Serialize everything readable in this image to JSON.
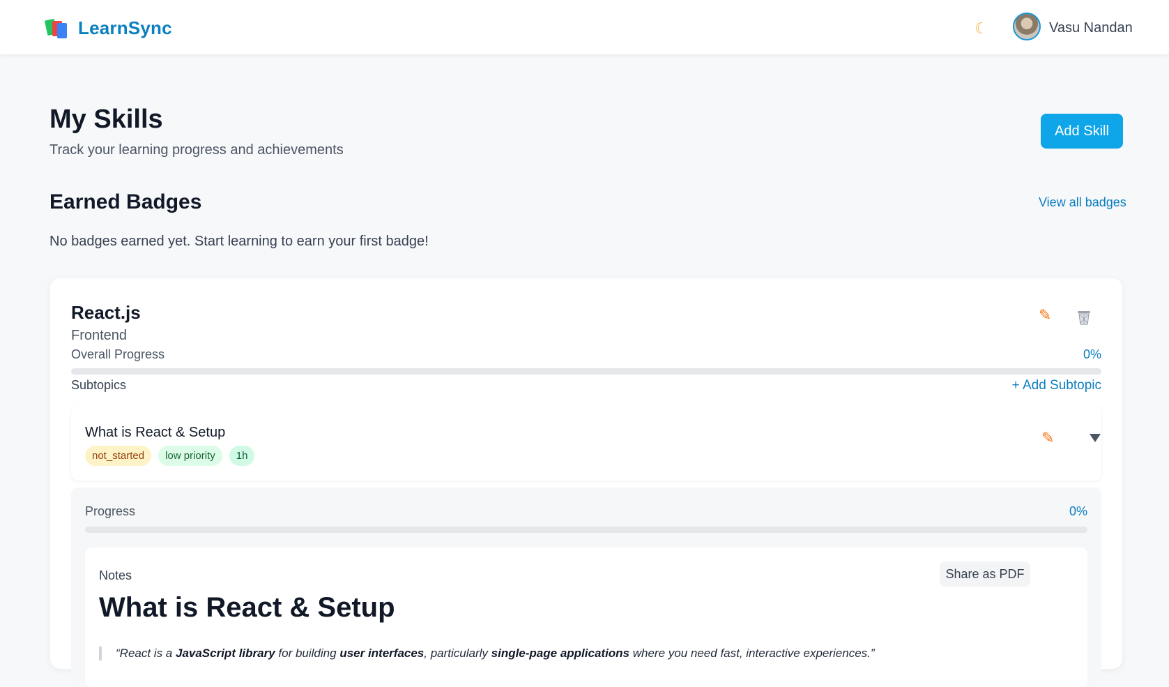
{
  "header": {
    "brand": "LearnSync",
    "user_name": "Vasu Nandan",
    "theme_icon": "moon-icon"
  },
  "page": {
    "title": "My Skills",
    "subtitle": "Track your learning progress and achievements",
    "add_skill_label": "Add Skill"
  },
  "badges": {
    "title": "Earned Badges",
    "view_all_label": "View all badges",
    "empty_text": "No badges earned yet. Start learning to earn your first badge!"
  },
  "skill": {
    "name": "React.js",
    "category": "Frontend",
    "overall_label": "Overall Progress",
    "overall_percent_text": "0%",
    "overall_progress": 0,
    "subtopics_label": "Subtopics",
    "add_subtopic_label": "+ Add Subtopic",
    "subtopics": [
      {
        "name": "What is React & Setup",
        "status": "not_started",
        "priority": "low priority",
        "duration": "1h",
        "progress_label": "Progress",
        "progress_percent_text": "0%",
        "progress": 0,
        "notes_label": "Notes",
        "share_label": "Share as PDF",
        "notes_heading": "What is React & Setup",
        "quote": {
          "p1": "“React is a ",
          "b1": "JavaScript library",
          "p2": " for building ",
          "b2": "user interfaces",
          "p3": ", particularly ",
          "b3": "single-page applications",
          "p4": " where you need fast, interactive experiences.”"
        }
      }
    ]
  },
  "colors": {
    "accent": "#0ea5e9",
    "link": "#0b7fbf",
    "edit_icon": "#f97316"
  }
}
